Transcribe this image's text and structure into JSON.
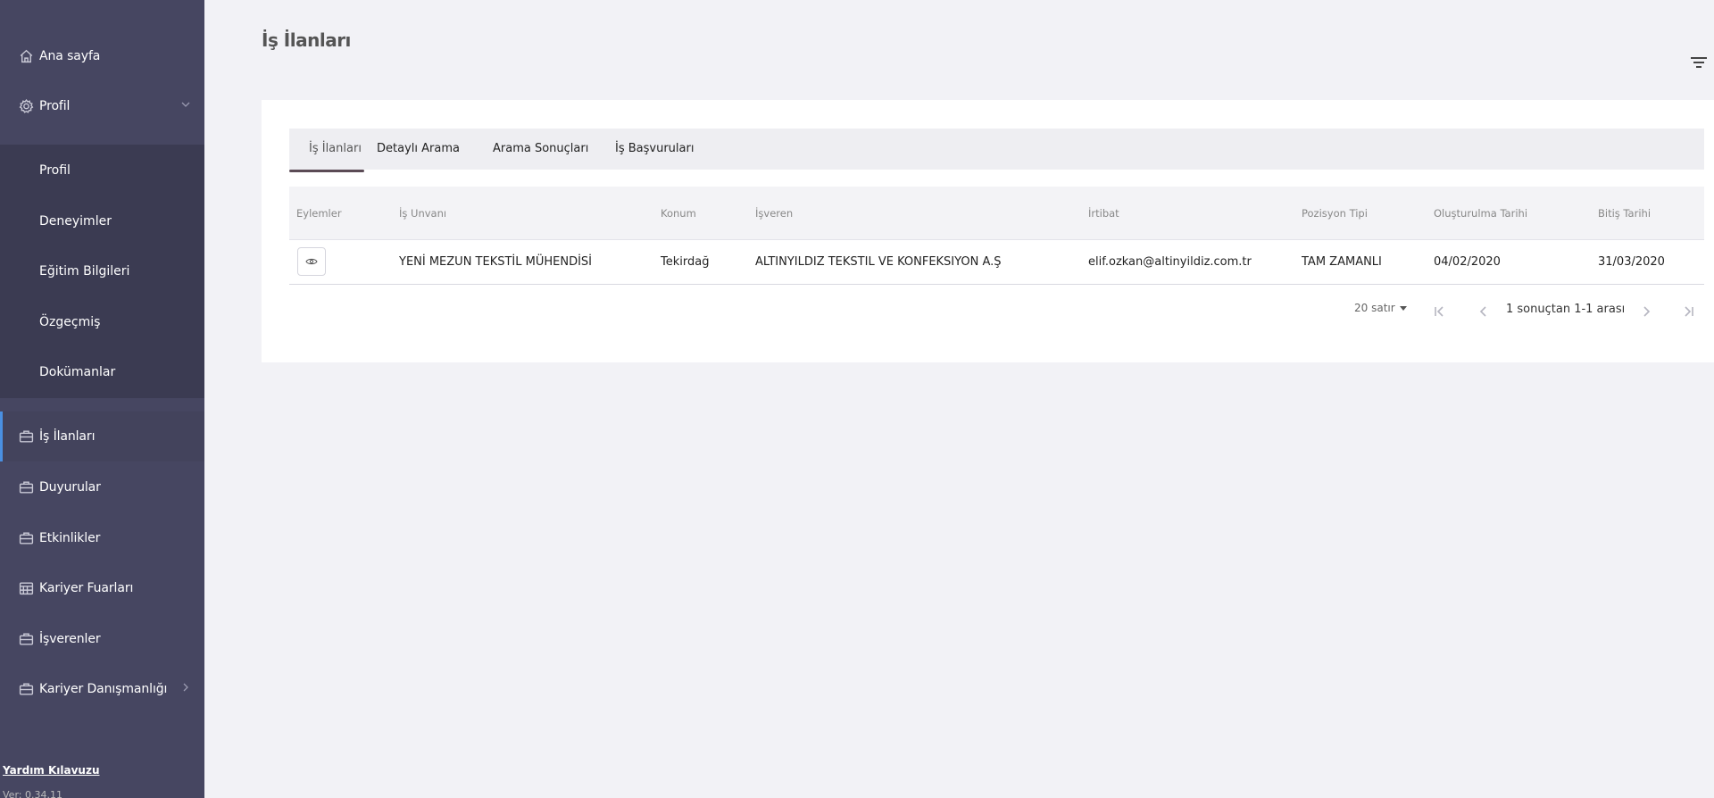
{
  "sidebar": {
    "items": [
      {
        "label": "Ana sayfa",
        "icon": "home-icon"
      },
      {
        "label": "Profil",
        "icon": "gear-icon"
      },
      {
        "label": "İş İlanları",
        "icon": "briefcase-icon"
      },
      {
        "label": "Duyurular",
        "icon": "briefcase-icon"
      },
      {
        "label": "Etkinlikler",
        "icon": "briefcase-icon"
      },
      {
        "label": "Kariyer Fuarları",
        "icon": "calendar-icon"
      },
      {
        "label": "İşverenler",
        "icon": "briefcase-icon"
      },
      {
        "label": "Kariyer Danışmanlığı",
        "icon": "briefcase-icon"
      }
    ],
    "submenu": [
      "Profil",
      "Deneyimler",
      "Eğitim Bilgileri",
      "Özgeçmiş",
      "Dokümanlar"
    ],
    "help": "Yardım Kılavuzu",
    "version": "Ver: 0.34.11",
    "accent": "#4a90e2"
  },
  "page": {
    "title": "İş İlanları"
  },
  "tabs": [
    "İş İlanları",
    "Detaylı Arama",
    "Arama Sonuçları",
    "İş Başvuruları"
  ],
  "table": {
    "headers": [
      "Eylemler",
      "İş Unvanı",
      "Konum",
      "İşveren",
      "İrtibat",
      "Pozisyon Tipi",
      "Oluşturulma Tarihi",
      "Bitiş Tarihi"
    ],
    "rows": [
      {
        "title": "YENİ MEZUN TEKSTİL MÜHENDİSİ",
        "location": "Tekirdağ",
        "employer": "ALTINYILDIZ TEKSTIL VE KONFEKSIYON A.Ş",
        "contact": "elif.ozkan@altinyildiz.com.tr",
        "position_type": "TAM ZAMANLI",
        "created": "04/02/2020",
        "end": "31/03/2020"
      }
    ]
  },
  "pagination": {
    "rows_per_page": "20 satır",
    "info": "1 sonuçtan 1-1 arası"
  }
}
